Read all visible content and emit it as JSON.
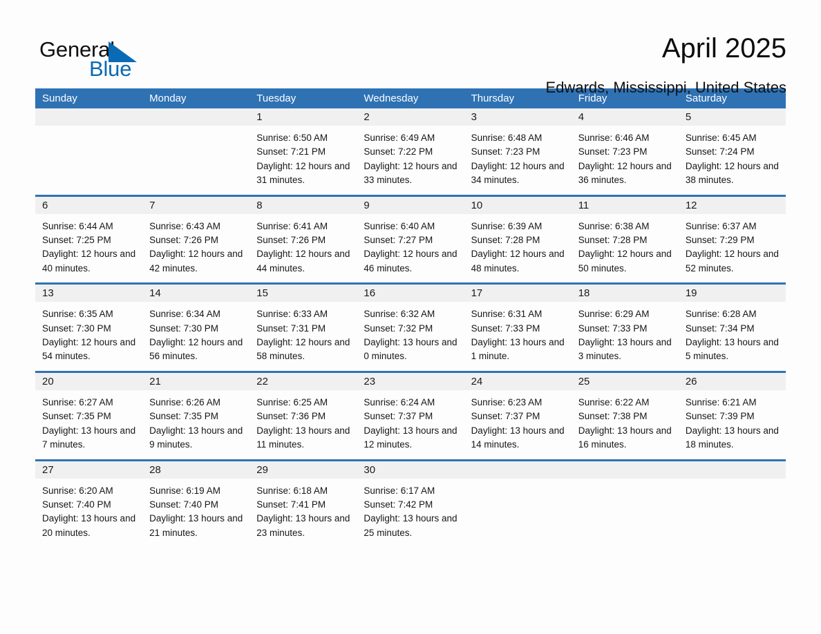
{
  "brand": {
    "name_part1": "General",
    "name_part2": "Blue",
    "accent_color": "#0a6ab4"
  },
  "header": {
    "title": "April 2025",
    "subtitle": "Edwards, Mississippi, United States"
  },
  "theme": {
    "header_blue": "#2f72b4",
    "day_band_gray": "#f0f0f0",
    "page_background": "#fdfdfd"
  },
  "weekdays": [
    "Sunday",
    "Monday",
    "Tuesday",
    "Wednesday",
    "Thursday",
    "Friday",
    "Saturday"
  ],
  "weeks": [
    [
      {
        "day": "",
        "sunrise": "",
        "sunset": "",
        "daylight": "",
        "empty": true
      },
      {
        "day": "",
        "sunrise": "",
        "sunset": "",
        "daylight": "",
        "empty": true
      },
      {
        "day": "1",
        "sunrise": "Sunrise: 6:50 AM",
        "sunset": "Sunset: 7:21 PM",
        "daylight": "Daylight: 12 hours and 31 minutes."
      },
      {
        "day": "2",
        "sunrise": "Sunrise: 6:49 AM",
        "sunset": "Sunset: 7:22 PM",
        "daylight": "Daylight: 12 hours and 33 minutes."
      },
      {
        "day": "3",
        "sunrise": "Sunrise: 6:48 AM",
        "sunset": "Sunset: 7:23 PM",
        "daylight": "Daylight: 12 hours and 34 minutes."
      },
      {
        "day": "4",
        "sunrise": "Sunrise: 6:46 AM",
        "sunset": "Sunset: 7:23 PM",
        "daylight": "Daylight: 12 hours and 36 minutes."
      },
      {
        "day": "5",
        "sunrise": "Sunrise: 6:45 AM",
        "sunset": "Sunset: 7:24 PM",
        "daylight": "Daylight: 12 hours and 38 minutes."
      }
    ],
    [
      {
        "day": "6",
        "sunrise": "Sunrise: 6:44 AM",
        "sunset": "Sunset: 7:25 PM",
        "daylight": "Daylight: 12 hours and 40 minutes."
      },
      {
        "day": "7",
        "sunrise": "Sunrise: 6:43 AM",
        "sunset": "Sunset: 7:26 PM",
        "daylight": "Daylight: 12 hours and 42 minutes."
      },
      {
        "day": "8",
        "sunrise": "Sunrise: 6:41 AM",
        "sunset": "Sunset: 7:26 PM",
        "daylight": "Daylight: 12 hours and 44 minutes."
      },
      {
        "day": "9",
        "sunrise": "Sunrise: 6:40 AM",
        "sunset": "Sunset: 7:27 PM",
        "daylight": "Daylight: 12 hours and 46 minutes."
      },
      {
        "day": "10",
        "sunrise": "Sunrise: 6:39 AM",
        "sunset": "Sunset: 7:28 PM",
        "daylight": "Daylight: 12 hours and 48 minutes."
      },
      {
        "day": "11",
        "sunrise": "Sunrise: 6:38 AM",
        "sunset": "Sunset: 7:28 PM",
        "daylight": "Daylight: 12 hours and 50 minutes."
      },
      {
        "day": "12",
        "sunrise": "Sunrise: 6:37 AM",
        "sunset": "Sunset: 7:29 PM",
        "daylight": "Daylight: 12 hours and 52 minutes."
      }
    ],
    [
      {
        "day": "13",
        "sunrise": "Sunrise: 6:35 AM",
        "sunset": "Sunset: 7:30 PM",
        "daylight": "Daylight: 12 hours and 54 minutes."
      },
      {
        "day": "14",
        "sunrise": "Sunrise: 6:34 AM",
        "sunset": "Sunset: 7:30 PM",
        "daylight": "Daylight: 12 hours and 56 minutes."
      },
      {
        "day": "15",
        "sunrise": "Sunrise: 6:33 AM",
        "sunset": "Sunset: 7:31 PM",
        "daylight": "Daylight: 12 hours and 58 minutes."
      },
      {
        "day": "16",
        "sunrise": "Sunrise: 6:32 AM",
        "sunset": "Sunset: 7:32 PM",
        "daylight": "Daylight: 13 hours and 0 minutes."
      },
      {
        "day": "17",
        "sunrise": "Sunrise: 6:31 AM",
        "sunset": "Sunset: 7:33 PM",
        "daylight": "Daylight: 13 hours and 1 minute."
      },
      {
        "day": "18",
        "sunrise": "Sunrise: 6:29 AM",
        "sunset": "Sunset: 7:33 PM",
        "daylight": "Daylight: 13 hours and 3 minutes."
      },
      {
        "day": "19",
        "sunrise": "Sunrise: 6:28 AM",
        "sunset": "Sunset: 7:34 PM",
        "daylight": "Daylight: 13 hours and 5 minutes."
      }
    ],
    [
      {
        "day": "20",
        "sunrise": "Sunrise: 6:27 AM",
        "sunset": "Sunset: 7:35 PM",
        "daylight": "Daylight: 13 hours and 7 minutes."
      },
      {
        "day": "21",
        "sunrise": "Sunrise: 6:26 AM",
        "sunset": "Sunset: 7:35 PM",
        "daylight": "Daylight: 13 hours and 9 minutes."
      },
      {
        "day": "22",
        "sunrise": "Sunrise: 6:25 AM",
        "sunset": "Sunset: 7:36 PM",
        "daylight": "Daylight: 13 hours and 11 minutes."
      },
      {
        "day": "23",
        "sunrise": "Sunrise: 6:24 AM",
        "sunset": "Sunset: 7:37 PM",
        "daylight": "Daylight: 13 hours and 12 minutes."
      },
      {
        "day": "24",
        "sunrise": "Sunrise: 6:23 AM",
        "sunset": "Sunset: 7:37 PM",
        "daylight": "Daylight: 13 hours and 14 minutes."
      },
      {
        "day": "25",
        "sunrise": "Sunrise: 6:22 AM",
        "sunset": "Sunset: 7:38 PM",
        "daylight": "Daylight: 13 hours and 16 minutes."
      },
      {
        "day": "26",
        "sunrise": "Sunrise: 6:21 AM",
        "sunset": "Sunset: 7:39 PM",
        "daylight": "Daylight: 13 hours and 18 minutes."
      }
    ],
    [
      {
        "day": "27",
        "sunrise": "Sunrise: 6:20 AM",
        "sunset": "Sunset: 7:40 PM",
        "daylight": "Daylight: 13 hours and 20 minutes."
      },
      {
        "day": "28",
        "sunrise": "Sunrise: 6:19 AM",
        "sunset": "Sunset: 7:40 PM",
        "daylight": "Daylight: 13 hours and 21 minutes."
      },
      {
        "day": "29",
        "sunrise": "Sunrise: 6:18 AM",
        "sunset": "Sunset: 7:41 PM",
        "daylight": "Daylight: 13 hours and 23 minutes."
      },
      {
        "day": "30",
        "sunrise": "Sunrise: 6:17 AM",
        "sunset": "Sunset: 7:42 PM",
        "daylight": "Daylight: 13 hours and 25 minutes."
      },
      {
        "day": "",
        "sunrise": "",
        "sunset": "",
        "daylight": "",
        "empty": true
      },
      {
        "day": "",
        "sunrise": "",
        "sunset": "",
        "daylight": "",
        "empty": true
      },
      {
        "day": "",
        "sunrise": "",
        "sunset": "",
        "daylight": "",
        "empty": true
      }
    ]
  ]
}
